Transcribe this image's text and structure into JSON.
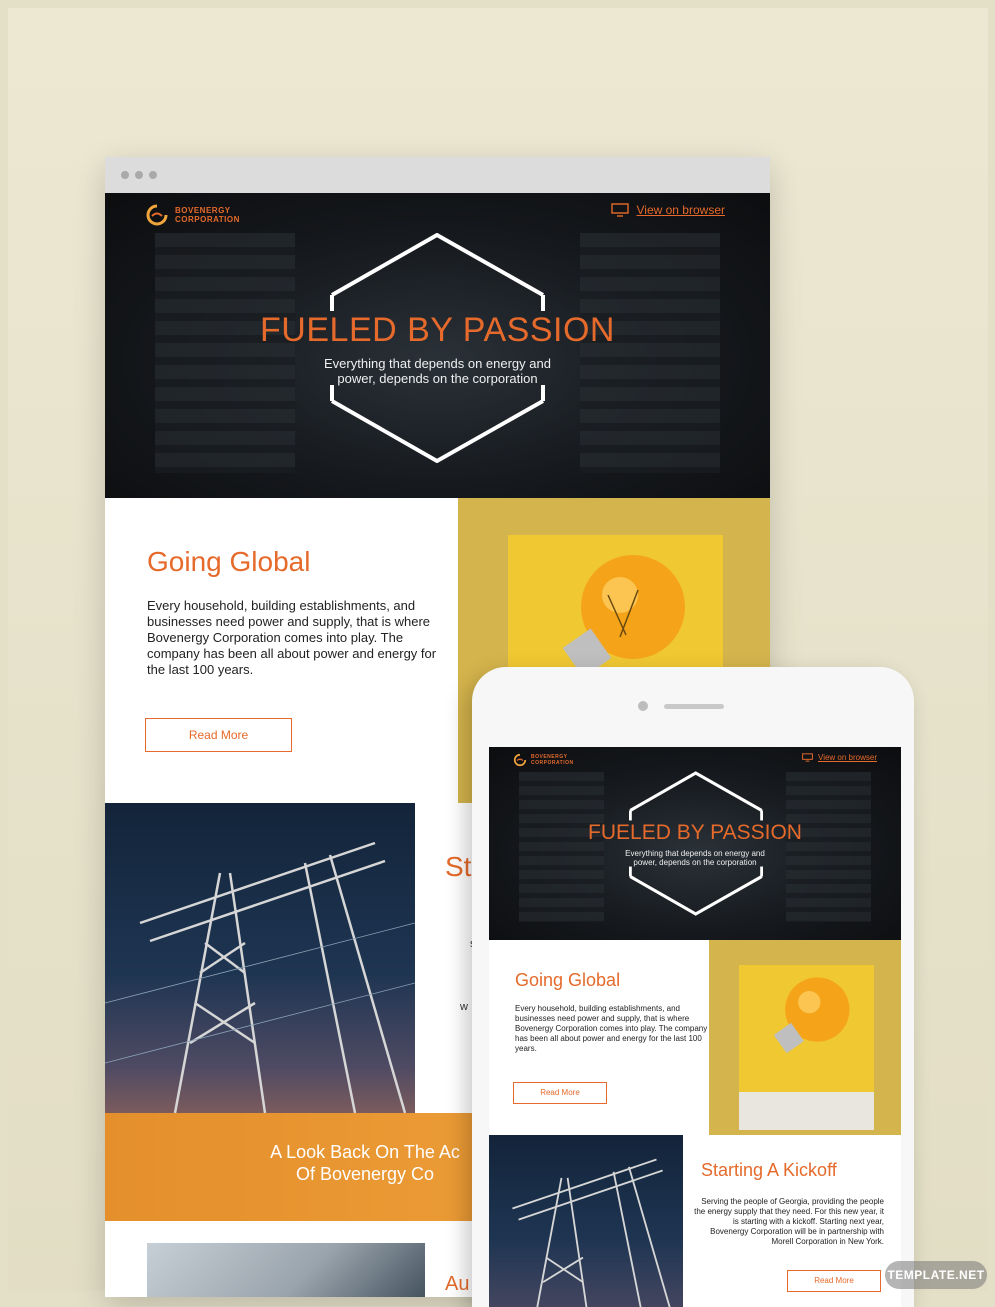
{
  "desktop": {
    "header": {
      "logo_line1": "BOVENERGY",
      "logo_line2": "CORPORATION",
      "view_link": "View on browser"
    },
    "hero": {
      "title": "FUELED BY PASSION",
      "subtitle_line1": "Everything that depends on energy and",
      "subtitle_line2": "power, depends on the corporation"
    },
    "section1": {
      "title": "Going Global",
      "body": "Every household, building establishments, and businesses need power and supply, that is where Bovenergy Corporation comes into play. The company has been all about power and energy for the last 100 years.",
      "button": "Read More"
    },
    "section2": {
      "title_fragment": "St",
      "fragment_a": "s",
      "fragment_b": "w"
    },
    "band": {
      "line1": "A Look Back On The Ac",
      "line2": "Of Bovenergy Co"
    },
    "section3": {
      "title_fragment": "Au"
    }
  },
  "mobile": {
    "header": {
      "logo_line1": "BOVENERGY",
      "logo_line2": "CORPORATION",
      "view_link": "View on browser"
    },
    "hero": {
      "title": "FUELED BY PASSION",
      "subtitle_line1": "Everything that depends on energy and",
      "subtitle_line2": "power, depends on the corporation"
    },
    "section1": {
      "title": "Going Global",
      "body": "Every household, building establishments, and businesses need power and supply, that is where Bovenergy Corporation comes into play. The company has been all about power and energy for the last 100 years.",
      "button": "Read More"
    },
    "section2": {
      "title": "Starting A Kickoff",
      "body": "Serving the people of Georgia, providing the people the energy supply that they need. For this new year, it is starting with a kickoff. Starting next year, Bovenergy Corporation will be in partnership with Morell Corporation in New York.",
      "button": "Read More"
    }
  },
  "watermark": "TEMPLATE.NET",
  "colors": {
    "accent": "#e56a2b",
    "hero_bg": "#15181c",
    "mustard": "#d4b44c",
    "band_orange": "#f0a43c"
  }
}
